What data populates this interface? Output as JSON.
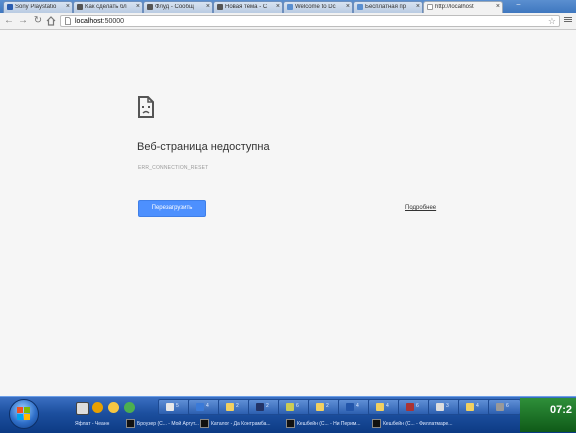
{
  "tabs": [
    {
      "label": "Sony Playstatio",
      "active": false,
      "fav_color": "#2a5db0"
    },
    {
      "label": "Как сделать бл",
      "active": false,
      "fav_color": "#555555"
    },
    {
      "label": "Флуд - Сообщ",
      "active": false,
      "fav_color": "#555555"
    },
    {
      "label": "Новая тема - С",
      "active": false,
      "fav_color": "#555555"
    },
    {
      "label": "Welcome to Dc",
      "active": false,
      "fav_color": "#5a8fd0"
    },
    {
      "label": "Бесплатная пр",
      "active": false,
      "fav_color": "#5a8fd0"
    },
    {
      "label": "http://localhost",
      "active": true,
      "fav_color": "#ffffff"
    }
  ],
  "address_bar": {
    "host": "localhost",
    "port": ":50000"
  },
  "error_page": {
    "title": "Веб-страница недоступна",
    "error_code": "ERR_CONNECTION_RESET",
    "reload_label": "Перезагрузить",
    "details_label": "Подробнее"
  },
  "taskbar": {
    "buttons": [
      {
        "num": "5",
        "color": "#e8e8e8"
      },
      {
        "num": "4",
        "color": "#3a7ad8"
      },
      {
        "num": "2",
        "color": "#f2d060"
      },
      {
        "num": "2",
        "color": "#223366"
      },
      {
        "num": "6",
        "color": "#cccc55"
      },
      {
        "num": "2",
        "color": "#f2d060"
      },
      {
        "num": "4",
        "color": "#2255aa"
      },
      {
        "num": "4",
        "color": "#f2d060"
      },
      {
        "num": "6",
        "color": "#aa3333"
      },
      {
        "num": "3",
        "color": "#dddddd"
      },
      {
        "num": "4",
        "color": "#f2d060"
      },
      {
        "num": "6",
        "color": "#999999"
      }
    ],
    "row2": [
      "Яфлат - Чеанн",
      "Броузер (С... - Мой Аргут...",
      "Каталог - Да Контрамба...",
      "Кешбейн (С... - Ни Перим...",
      "Кешбейн (С... - Филлатмаре..."
    ],
    "clock": "07:2"
  }
}
